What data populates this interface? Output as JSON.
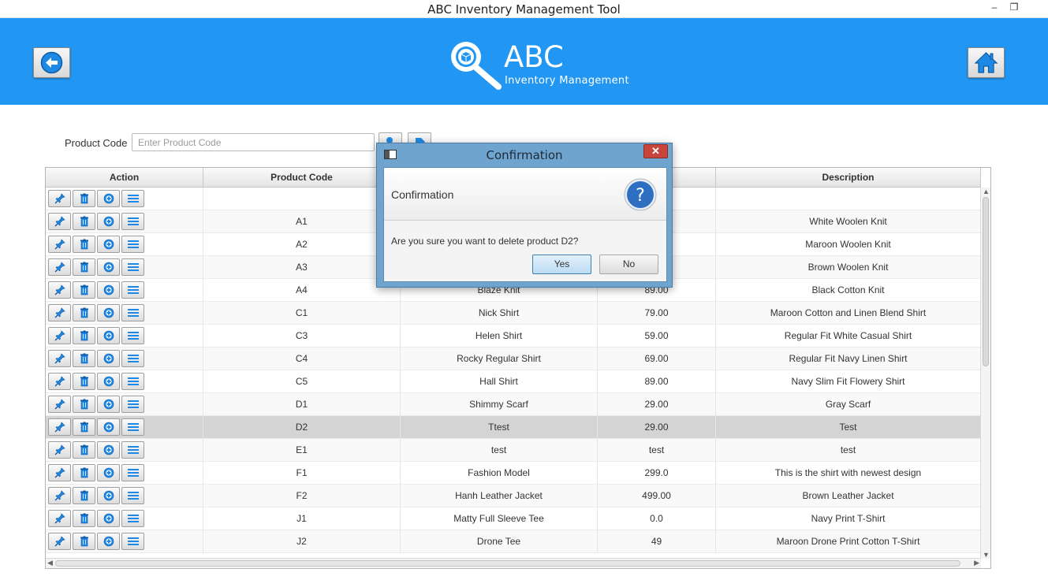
{
  "window": {
    "title": "ABC Inventory Management Tool",
    "minimize": "–",
    "restore": "❐"
  },
  "header": {
    "brand_title": "ABC",
    "brand_subtitle": "Inventory Management",
    "brand_color": "#2196f3",
    "back_icon": "arrow-left-icon",
    "home_icon": "home-icon"
  },
  "search": {
    "label": "Product Code",
    "placeholder": "Enter Product Code",
    "value": ""
  },
  "table": {
    "columns": [
      "Action",
      "Product Code",
      "",
      "",
      "Description"
    ],
    "action_icons": [
      "pin-icon",
      "trash-icon",
      "add-circle-icon",
      "list-icon"
    ],
    "rows": [
      {
        "code": "",
        "name": "",
        "price": "",
        "description": ""
      },
      {
        "code": "A1",
        "name": "",
        "price": "",
        "description": "White Woolen Knit"
      },
      {
        "code": "A2",
        "name": "",
        "price": "",
        "description": "Maroon Woolen Knit"
      },
      {
        "code": "A3",
        "name": "",
        "price": "",
        "description": "Brown Woolen Knit"
      },
      {
        "code": "A4",
        "name": "Blaze Knit",
        "price": "89.00",
        "description": "Black Cotton Knit"
      },
      {
        "code": "C1",
        "name": "Nick Shirt",
        "price": "79.00",
        "description": "Maroon Cotton and Linen Blend Shirt"
      },
      {
        "code": "C3",
        "name": "Helen Shirt",
        "price": "59.00",
        "description": "Regular Fit White Casual Shirt"
      },
      {
        "code": "C4",
        "name": "Rocky Regular Shirt",
        "price": "69.00",
        "description": "Regular Fit Navy Linen Shirt"
      },
      {
        "code": "C5",
        "name": "Hall Shirt",
        "price": "89.00",
        "description": "Navy Slim Fit Flowery Shirt"
      },
      {
        "code": "D1",
        "name": "Shimmy Scarf",
        "price": "29.00",
        "description": "Gray Scarf"
      },
      {
        "code": "D2",
        "name": "Ttest",
        "price": "29.00",
        "description": "Test",
        "selected": true
      },
      {
        "code": "E1",
        "name": "test",
        "price": "test",
        "description": "test"
      },
      {
        "code": "F1",
        "name": "Fashion Model",
        "price": "299.0",
        "description": "This is the shirt with newest design"
      },
      {
        "code": "F2",
        "name": "Hanh Leather Jacket",
        "price": "499.00",
        "description": "Brown Leather Jacket"
      },
      {
        "code": "J1",
        "name": "Matty Full Sleeve Tee",
        "price": "0.0",
        "description": "Navy Print T-Shirt"
      },
      {
        "code": "J2",
        "name": "Drone Tee",
        "price": "49",
        "description": "Maroon Drone Print Cotton T-Shirt"
      }
    ]
  },
  "dialog": {
    "title": "Confirmation",
    "close": "✕",
    "header": "Confirmation",
    "message": "Are you sure you want to delete product D2?",
    "icon": "question-icon",
    "yes_label": "Yes",
    "no_label": "No"
  }
}
